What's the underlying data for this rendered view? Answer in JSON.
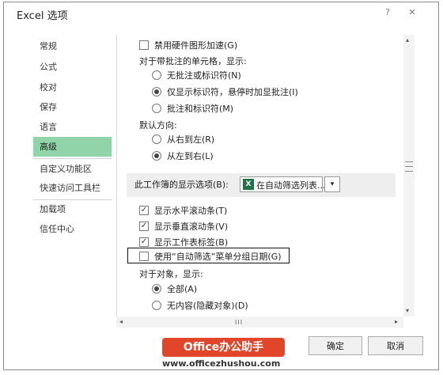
{
  "window": {
    "title": "Excel 选项",
    "help_glyph": "?",
    "close_glyph": "✕"
  },
  "sidebar": {
    "items": [
      {
        "label": "常规"
      },
      {
        "label": "公式"
      },
      {
        "label": "校对"
      },
      {
        "label": "保存"
      },
      {
        "label": "语言"
      },
      {
        "label": "高级",
        "active": true
      },
      {
        "label": "自定义功能区"
      },
      {
        "label": "快速访问工具栏"
      },
      {
        "label": "加载项"
      },
      {
        "label": "信任中心"
      }
    ]
  },
  "content": {
    "disable_hw_accel": {
      "label": "禁用硬件图形加速(G)",
      "checked": false
    },
    "comments_heading": "对于带批注的单元格，显示:",
    "comments_options": [
      {
        "label": "无批注或标识符(N)",
        "selected": false
      },
      {
        "label": "仅显示标识符，悬停时加显批注(I)",
        "selected": true
      },
      {
        "label": "批注和标识符(M)",
        "selected": false
      }
    ],
    "direction_heading": "默认方向:",
    "direction_options": [
      {
        "label": "从右到左(R)",
        "selected": false
      },
      {
        "label": "从左到右(L)",
        "selected": true
      }
    ],
    "worksheet_section": {
      "label": "此工作簿的显示选项(B):",
      "selected_value": "在自动筛选列表...",
      "icon": "excel-icon"
    },
    "display_checkboxes": [
      {
        "label": "显示水平滚动条(T)",
        "checked": true
      },
      {
        "label": "显示垂直滚动条(V)",
        "checked": true
      },
      {
        "label": "显示工作表标签(B)",
        "checked": true
      },
      {
        "label": "使用“自动筛选”菜单分组日期(G)",
        "checked": false
      }
    ],
    "objects_heading": "对于对象，显示:",
    "objects_options": [
      {
        "label": "全部(A)",
        "selected": true
      },
      {
        "label": "无内容(隐藏对象)(D)",
        "selected": false
      }
    ]
  },
  "scroll": {
    "hthumb": "III",
    "left_arrow": "◂",
    "right_arrow": "▸",
    "up_arrow": "▴",
    "down_arrow": "▾"
  },
  "buttons": {
    "ok": "确定",
    "cancel": "取消"
  },
  "watermark": {
    "badge": "Office办公助手",
    "url": "www.officezhushou.com"
  },
  "colors": {
    "active_sidebar": "#92d4a9",
    "watermark": "#e1452a"
  }
}
